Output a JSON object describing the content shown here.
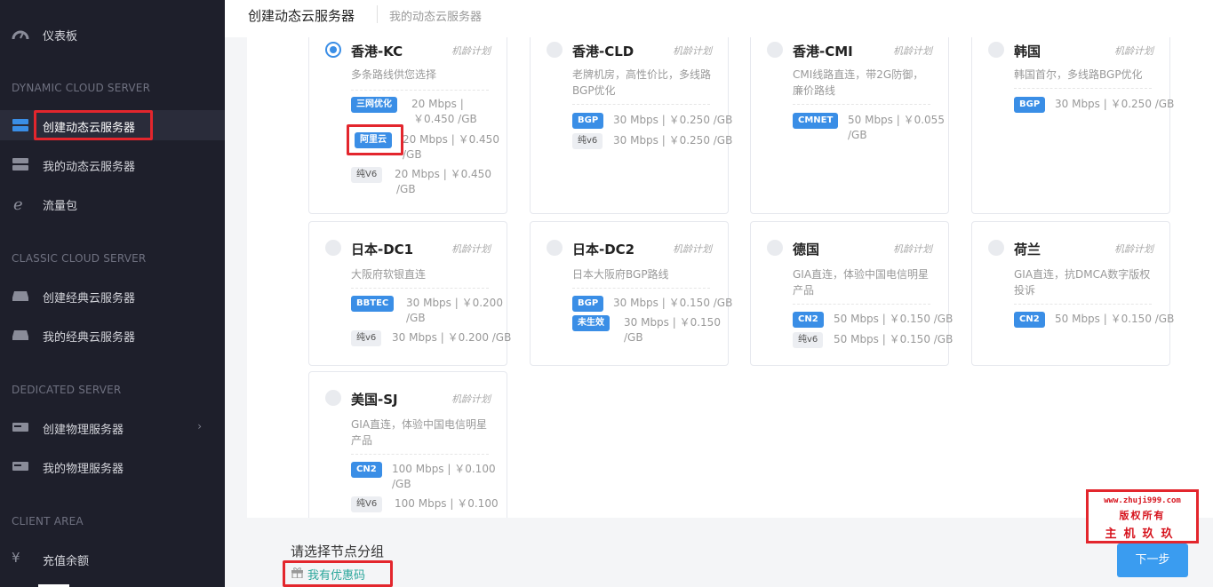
{
  "sidebar": {
    "dashboard": "仪表板",
    "sections": {
      "dynamic": "DYNAMIC CLOUD SERVER",
      "classic": "CLASSIC CLOUD SERVER",
      "dedicated": "DEDICATED SERVER",
      "client": "CLIENT AREA"
    },
    "items": {
      "create_dynamic": "创建动态云服务器",
      "my_dynamic": "我的动态云服务器",
      "traffic": "流量包",
      "create_classic": "创建经典云服务器",
      "my_classic": "我的经典云服务器",
      "create_physical": "创建物理服务器",
      "my_physical": "我的物理服务器",
      "recharge": "充值余额"
    }
  },
  "header": {
    "title": "创建动态云服务器",
    "breadcrumb": "我的动态云服务器"
  },
  "cards": [
    {
      "name": "香港-KC",
      "plan": "机龄计划",
      "selected": true,
      "desc": "多条路线供您选择",
      "lines": [
        {
          "badge": "三网优化",
          "style": "blue",
          "text1": "20 Mbps |",
          "text2": "￥0.450 /GB"
        },
        {
          "badge": "阿里云",
          "style": "blue",
          "text1": "20 Mbps | ￥0.450",
          "text2": "/GB"
        },
        {
          "badge": "纯V6",
          "style": "gray",
          "text1": "20 Mbps | ￥0.450",
          "text2": "/GB"
        }
      ]
    },
    {
      "name": "香港-CLD",
      "plan": "机龄计划",
      "selected": false,
      "desc": "老牌机房，高性价比，多线路BGP优化",
      "lines": [
        {
          "badge": "BGP",
          "style": "blue",
          "text1": "30 Mbps | ￥0.250 /GB",
          "text2": ""
        },
        {
          "badge": "纯v6",
          "style": "gray",
          "text1": "30 Mbps | ￥0.250 /GB",
          "text2": ""
        }
      ]
    },
    {
      "name": "香港-CMI",
      "plan": "机龄计划",
      "selected": false,
      "desc": "CMI线路直连，带2G防御，廉价路线",
      "lines": [
        {
          "badge": "CMNET",
          "style": "blue",
          "text1": "50 Mbps | ￥0.055",
          "text2": "/GB"
        }
      ]
    },
    {
      "name": "韩国",
      "plan": "机龄计划",
      "selected": false,
      "desc": "韩国首尔，多线路BGP优化",
      "lines": [
        {
          "badge": "BGP",
          "style": "blue",
          "text1": "30 Mbps | ￥0.250 /GB",
          "text2": ""
        }
      ]
    },
    {
      "name": "日本-DC1",
      "plan": "机龄计划",
      "selected": false,
      "desc": "大阪府软银直连",
      "lines": [
        {
          "badge": "BBTEC",
          "style": "blue",
          "text1": "30 Mbps | ￥0.200",
          "text2": "/GB"
        },
        {
          "badge": "纯v6",
          "style": "gray",
          "text1": "30 Mbps | ￥0.200 /GB",
          "text2": ""
        }
      ]
    },
    {
      "name": "日本-DC2",
      "plan": "机龄计划",
      "selected": false,
      "desc": "日本大阪府BGP路线",
      "lines": [
        {
          "badge": "BGP",
          "style": "blue",
          "text1": "30 Mbps | ￥0.150 /GB",
          "text2": ""
        },
        {
          "badge": "未生效",
          "style": "blue",
          "text1": "30 Mbps | ￥0.150",
          "text2": "/GB"
        }
      ]
    },
    {
      "name": "德国",
      "plan": "机龄计划",
      "selected": false,
      "desc": "GIA直连，体验中国电信明星产品",
      "lines": [
        {
          "badge": "CN2",
          "style": "blue",
          "text1": "50 Mbps | ￥0.150 /GB",
          "text2": ""
        },
        {
          "badge": "纯v6",
          "style": "gray",
          "text1": "50 Mbps | ￥0.150 /GB",
          "text2": ""
        }
      ]
    },
    {
      "name": "荷兰",
      "plan": "机龄计划",
      "selected": false,
      "desc": "GIA直连，抗DMCA数字版权投诉",
      "lines": [
        {
          "badge": "CN2",
          "style": "blue",
          "text1": "50 Mbps | ￥0.150 /GB",
          "text2": ""
        }
      ]
    },
    {
      "name": "美国-SJ",
      "plan": "机龄计划",
      "selected": false,
      "desc": "GIA直连，体验中国电信明星产品",
      "lines": [
        {
          "badge": "CN2",
          "style": "blue",
          "text1": "100 Mbps | ￥0.100",
          "text2": "/GB"
        },
        {
          "badge": "纯V6",
          "style": "gray",
          "text1": "100 Mbps | ￥0.100",
          "text2": ""
        }
      ]
    }
  ],
  "footer": {
    "prompt": "请选择节点分组",
    "coupon": "我有优惠码",
    "next": "下一步"
  },
  "watermark": {
    "url": "www.zhuji999.com",
    "rights": "版权所有",
    "brand": "主机玖玖"
  },
  "colors": {
    "accent": "#3a8ee6",
    "sidebar_bg": "#1e1f2b",
    "highlight_red": "#e3262d",
    "coupon_green": "#2aa69b"
  }
}
